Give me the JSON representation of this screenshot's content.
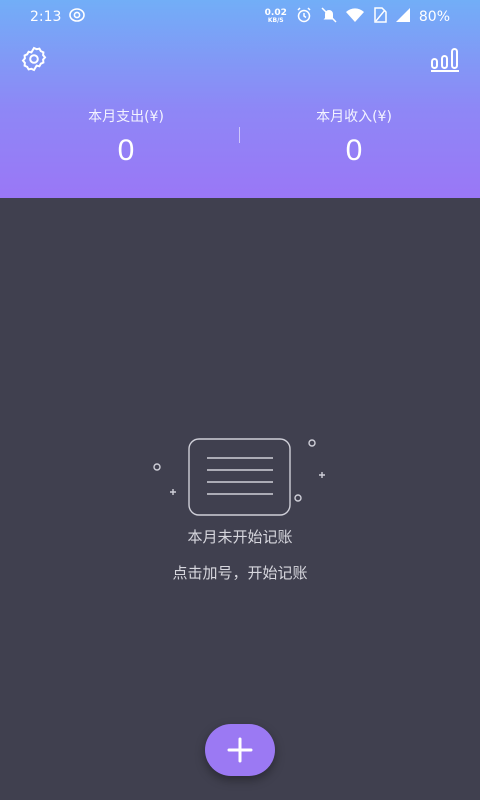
{
  "status_bar": {
    "time": "2:13",
    "net_speed_value": "0.02",
    "net_speed_unit": "KB/S",
    "battery": "80%",
    "icons": [
      "eye-icon",
      "alarm-icon",
      "mute-icon",
      "wifi-icon",
      "sim-icon",
      "signal-icon"
    ]
  },
  "header": {
    "left_icon": "gear-icon",
    "right_icon": "bar-chart-icon",
    "expense_label": "本月支出(¥)",
    "expense_value": "0",
    "income_label": "本月收入(¥)",
    "income_value": "0",
    "gradient_colors": [
      "#72AEF7",
      "#9A77F6"
    ]
  },
  "empty_state": {
    "icon": "empty-document-icon",
    "title": "本月未开始记账",
    "subtitle": "点击加号，开始记账"
  },
  "fab": {
    "icon": "plus-icon",
    "color": "#9B79F3"
  },
  "background_color": "#40404F"
}
